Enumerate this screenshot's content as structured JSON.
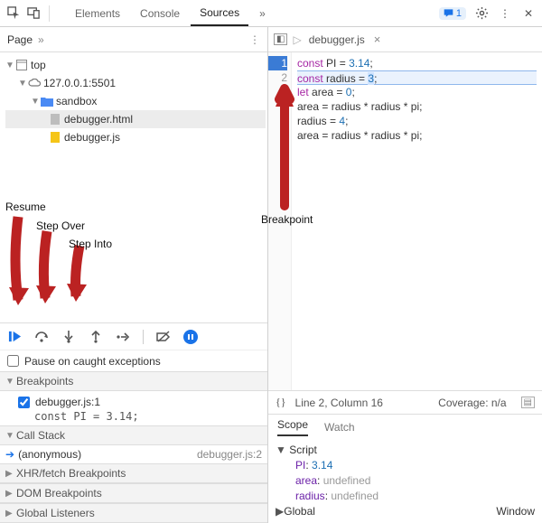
{
  "topbar": {
    "tabs": [
      "Elements",
      "Console",
      "Sources"
    ],
    "active_tab": "Sources",
    "message_count": "1"
  },
  "page_panel": {
    "label": "Page",
    "tree": {
      "root": "top",
      "host": "127.0.0.1:5501",
      "folder": "sandbox",
      "files": [
        "debugger.html",
        "debugger.js"
      ],
      "selected": "debugger.html"
    }
  },
  "annotations": {
    "resume": "Resume",
    "step_over": "Step Over",
    "step_into": "Step Into",
    "breakpoint": "Breakpoint"
  },
  "pause_caught": "Pause on caught exceptions",
  "sections": {
    "breakpoints": "Breakpoints",
    "call_stack": "Call Stack",
    "xhr": "XHR/fetch Breakpoints",
    "dom": "DOM Breakpoints",
    "global": "Global Listeners"
  },
  "breakpoints": [
    {
      "label": "debugger.js:1",
      "code": "const PI = 3.14;"
    }
  ],
  "call_stack": [
    {
      "fn": "(anonymous)",
      "loc": "debugger.js:2"
    }
  ],
  "source": {
    "filename": "debugger.js",
    "lines": [
      "const PI = 3.14;",
      "const radius = 3;",
      "let area = 0;",
      "area = radius * radius * pi;",
      "radius = 4;",
      "area = radius * radius * pi;",
      ""
    ],
    "breakpoint_line": 1,
    "current_line": 2,
    "status": {
      "pos": "Line 2, Column 16",
      "coverage": "Coverage: n/a"
    }
  },
  "bottom_tabs": {
    "scope": "Scope",
    "watch": "Watch"
  },
  "scope": {
    "script_label": "Script",
    "vars": [
      {
        "name": "PI",
        "value": "3.14",
        "type": "num"
      },
      {
        "name": "area",
        "value": "undefined",
        "type": "undef"
      },
      {
        "name": "radius",
        "value": "undefined",
        "type": "undef"
      }
    ],
    "global_label": "Global",
    "global_value": "Window"
  }
}
